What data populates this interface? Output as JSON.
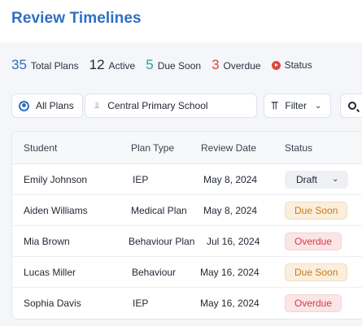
{
  "header": {
    "title": "Review Timelines"
  },
  "stats": [
    {
      "value": "35",
      "label": "Total Plans",
      "color": "#2f6fc3"
    },
    {
      "value": "12",
      "label": "Active",
      "color": "#1f2733"
    },
    {
      "value": "5",
      "label": "Due Soon",
      "color": "#2aa198"
    },
    {
      "value": "3",
      "label": "Overdue",
      "color": "#d9473d"
    }
  ],
  "status_legend": {
    "label": "Status",
    "icon": "record-icon",
    "color": "#e0473f"
  },
  "controls": {
    "all_plans": "All Plans",
    "school": "Central Primary School",
    "filter": "Filter"
  },
  "table": {
    "columns": [
      "Student",
      "Plan Type",
      "Review Date",
      "Status"
    ],
    "rows": [
      {
        "student": "Emily Johnson",
        "plan": "IEP",
        "date": "May 8, 2024",
        "status": "Draft"
      },
      {
        "student": "Aiden Williams",
        "plan": "Medical Plan",
        "date": "May 8, 2024",
        "status": "Due Soon"
      },
      {
        "student": "Mia Brown",
        "plan": "Behaviour Plan",
        "date": "Jul 16, 2024",
        "status": "Overdue"
      },
      {
        "student": "Lucas Miller",
        "plan": "Behaviour",
        "date": "May 16, 2024",
        "status": "Due Soon"
      },
      {
        "student": "Sophia Davis",
        "plan": "IEP",
        "date": "May 16, 2024",
        "status": "Overdue"
      }
    ]
  }
}
